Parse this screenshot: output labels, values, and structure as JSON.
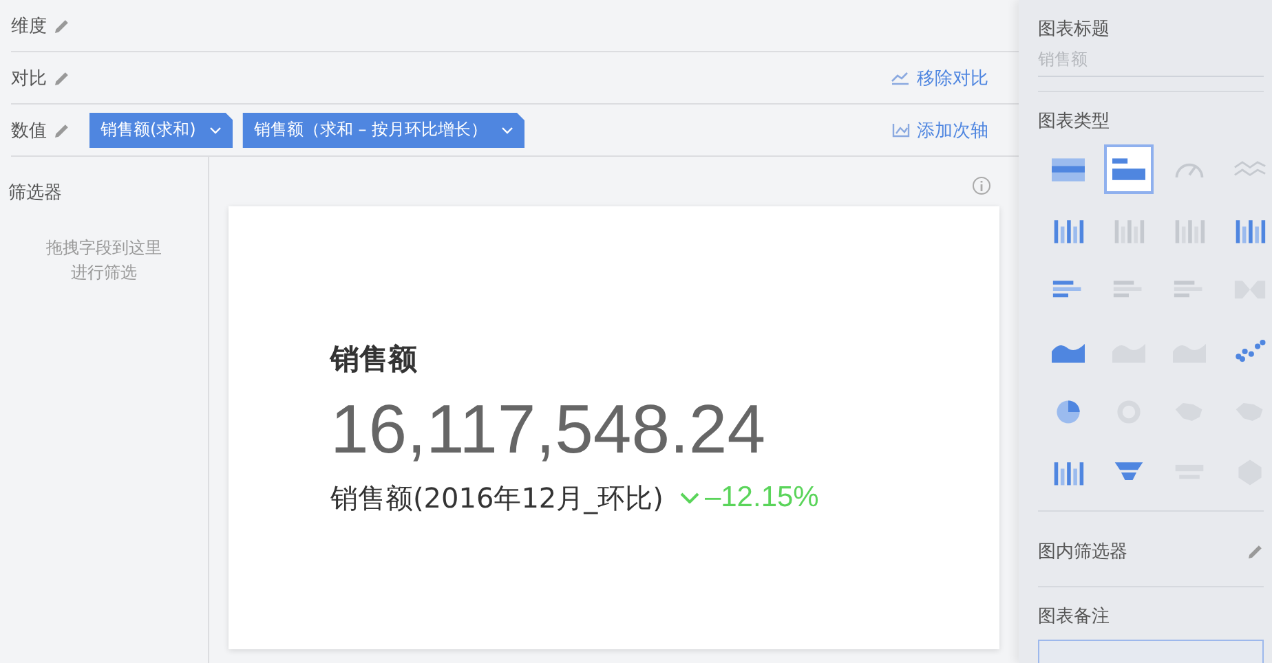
{
  "shelves": [
    {
      "label": "维度"
    },
    {
      "label": "对比",
      "action": {
        "kind": "remove-compare",
        "label": "移除对比"
      }
    },
    {
      "label": "数值",
      "fields": [
        {
          "label": "销售额(求和)"
        },
        {
          "label": "销售额（求和 – 按月环比增长）"
        }
      ],
      "action": {
        "kind": "secondary-axis",
        "label": "添加次轴"
      }
    }
  ],
  "filter_panel": {
    "title": "筛选器",
    "hint_lines": [
      "拖拽字段到这里",
      "进行筛选"
    ]
  },
  "kpi_card": {
    "title": "销售额",
    "value": "16,117,548.24",
    "compare_label": "销售额(2016年12月_环比)",
    "trend_down": true,
    "change": "–12.15%"
  },
  "settings": {
    "title_label": "图表标题",
    "title_placeholder": "销售额",
    "type_label": "图表类型",
    "chart_types": [
      {
        "kind": "table",
        "selected": false,
        "disabled": false
      },
      {
        "kind": "kpi",
        "selected": true,
        "disabled": false
      },
      {
        "kind": "gauge",
        "selected": false,
        "disabled": true
      },
      {
        "kind": "line",
        "selected": false,
        "disabled": true
      },
      {
        "kind": "column",
        "selected": false,
        "disabled": false
      },
      {
        "kind": "stacked-column",
        "selected": false,
        "disabled": true
      },
      {
        "kind": "percent-column",
        "selected": false,
        "disabled": true
      },
      {
        "kind": "range",
        "selected": false,
        "disabled": false
      },
      {
        "kind": "bar",
        "selected": false,
        "disabled": false
      },
      {
        "kind": "stacked-bar",
        "selected": false,
        "disabled": true
      },
      {
        "kind": "percent-bar",
        "selected": false,
        "disabled": true
      },
      {
        "kind": "sankey",
        "selected": false,
        "disabled": true
      },
      {
        "kind": "area",
        "selected": false,
        "disabled": false
      },
      {
        "kind": "stacked-area",
        "selected": false,
        "disabled": true
      },
      {
        "kind": "percent-area",
        "selected": false,
        "disabled": true
      },
      {
        "kind": "scatter",
        "selected": false,
        "disabled": false
      },
      {
        "kind": "pie",
        "selected": false,
        "disabled": false
      },
      {
        "kind": "ring",
        "selected": false,
        "disabled": true
      },
      {
        "kind": "map",
        "selected": false,
        "disabled": true
      },
      {
        "kind": "map",
        "selected": false,
        "disabled": true
      },
      {
        "kind": "combo",
        "selected": false,
        "disabled": false
      },
      {
        "kind": "funnel",
        "selected": false,
        "disabled": false
      },
      {
        "kind": "wordcloud",
        "selected": false,
        "disabled": true
      },
      {
        "kind": "radar",
        "selected": false,
        "disabled": true
      }
    ],
    "inner_filter_label": "图内筛选器",
    "note_label": "图表备注"
  }
}
